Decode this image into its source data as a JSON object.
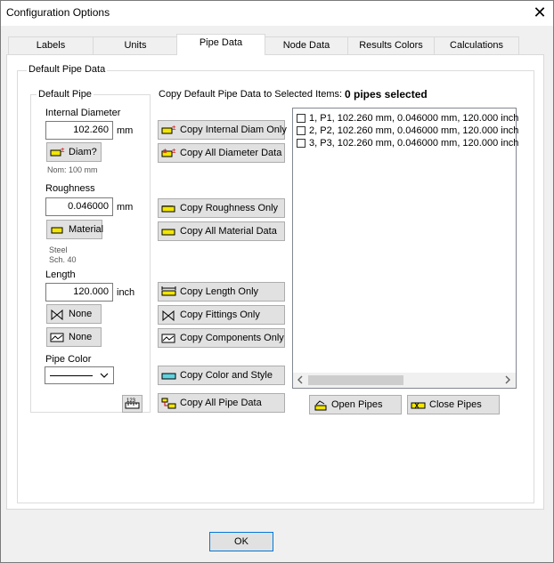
{
  "window": {
    "title": "Configuration Options"
  },
  "tabs": [
    {
      "label": "Labels"
    },
    {
      "label": "Units"
    },
    {
      "label": "Pipe Data"
    },
    {
      "label": "Node Data"
    },
    {
      "label": "Results Colors"
    },
    {
      "label": "Calculations"
    }
  ],
  "group": {
    "title": "Default Pipe Data",
    "default_pipe": {
      "title": "Default Pipe",
      "internal_diameter_label": "Internal Diameter",
      "internal_diameter_value": "102.260",
      "diameter_unit": "mm",
      "diam_button": "Diam?",
      "nominal_text": "Nom: 100 mm",
      "roughness_label": "Roughness",
      "roughness_value": "0.046000",
      "roughness_unit": "mm",
      "material_button": "Material",
      "material_line1": "Steel",
      "material_line2": "Sch. 40",
      "length_label": "Length",
      "length_value": "120.000",
      "length_unit": "inch",
      "fittings_button": "None",
      "components_button": "None",
      "pipe_color_label": "Pipe Color"
    },
    "copy": {
      "header": "Copy Default Pipe Data to Selected Items:",
      "selected": "0 pipes selected",
      "buttons": {
        "internal_diam": "Copy Internal Diam Only",
        "all_diameter": "Copy All Diameter Data",
        "roughness": "Copy Roughness Only",
        "all_material": "Copy All Material Data",
        "length": "Copy Length Only",
        "fittings": "Copy Fittings Only",
        "components": "Copy Components Only",
        "color_style": "Copy Color and Style",
        "all_pipe": "Copy All Pipe Data"
      }
    },
    "pipes": [
      "1, P1, 102.260 mm, 0.046000 mm, 120.000 inch",
      "2, P2, 102.260 mm, 0.046000 mm, 120.000 inch",
      "3, P3, 102.260 mm, 0.046000 mm, 120.000 inch"
    ],
    "open_pipes": "Open Pipes",
    "close_pipes": "Close Pipes"
  },
  "ok_button": "OK",
  "colors": {
    "accent": "#0078d7",
    "icon_yellow": "#f2e600",
    "icon_red": "#d00000",
    "icon_cyan": "#5fd3e0"
  }
}
